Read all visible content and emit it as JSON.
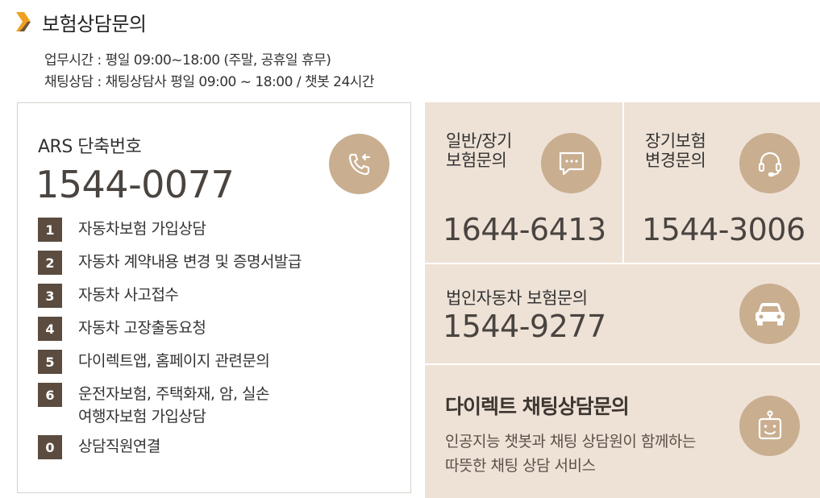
{
  "header": {
    "title": "보험상담문의",
    "hours_line1": "업무시간 : 평일 09:00~18:00 (주말, 공휴일 휴무)",
    "hours_line2": "채팅상담 : 채팅상담사 평일 09:00 ~ 18:00 / 챗봇 24시간"
  },
  "ars": {
    "label": "ARS 단축번호",
    "number": "1544-0077",
    "icon": "phone-callback-icon",
    "menu": [
      {
        "num": "1",
        "text": "자동차보험 가입상담"
      },
      {
        "num": "2",
        "text": "자동차 계약내용 변경 및 증명서발급"
      },
      {
        "num": "3",
        "text": "자동차 사고접수"
      },
      {
        "num": "4",
        "text": "자동차 고장출동요청"
      },
      {
        "num": "5",
        "text": "다이렉트앱, 홈페이지 관련문의"
      },
      {
        "num": "6",
        "text": "운전자보험, 주택화재, 암, 실손",
        "text2": "여행자보험 가입상담"
      },
      {
        "num": "0",
        "text": "상담직원연결"
      }
    ]
  },
  "general": {
    "label_line1": "일반/장기",
    "label_line2": "보험문의",
    "number": "1644-6413",
    "icon": "chat-bubble-icon"
  },
  "long_term": {
    "label_line1": "장기보험",
    "label_line2": "변경문의",
    "number": "1544-3006",
    "icon": "headset-icon"
  },
  "corporate": {
    "label": "법인자동차 보험문의",
    "number": "1544-9277",
    "icon": "car-icon"
  },
  "chat": {
    "title": "다이렉트 채팅상담문의",
    "desc_line1": "인공지능 챗봇과 채팅 상담원이 함께하는",
    "desc_line2": "따뜻한 채팅 상담 서비스",
    "icon": "robot-icon"
  },
  "colors": {
    "accent_orange": "#f0a020",
    "icon_circle": "#c9ae8f",
    "panel_bg": "#eee2d7",
    "badge_bg": "#5b4c3f"
  }
}
